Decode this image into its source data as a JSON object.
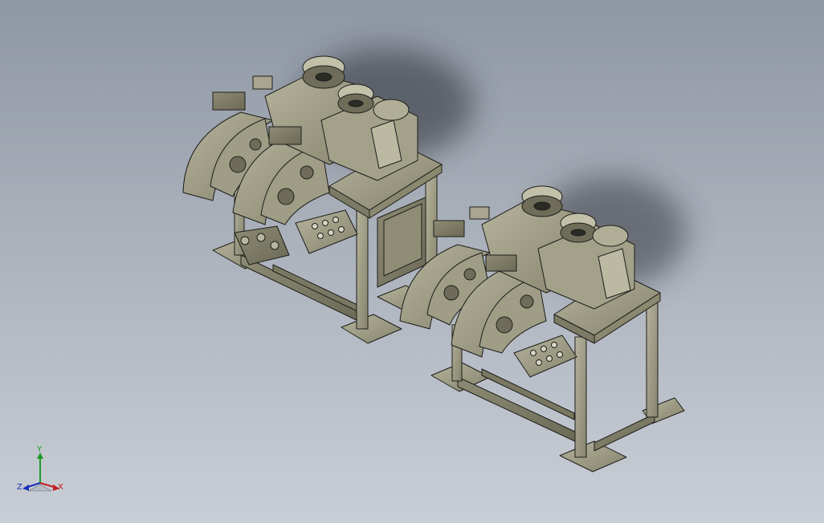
{
  "viewport": {
    "background_top": "#8f97a3",
    "background_bottom": "#c9ced6",
    "model_color": "#9c9a82",
    "edge_color": "#1e1e1a",
    "shadow_color": "#2a2e35"
  },
  "triad": {
    "y_label": "Y",
    "x_label": "X",
    "z_label": "Z",
    "y_color": "#1f9a2a",
    "x_color": "#c21e1e",
    "z_color": "#1a2fb8"
  }
}
